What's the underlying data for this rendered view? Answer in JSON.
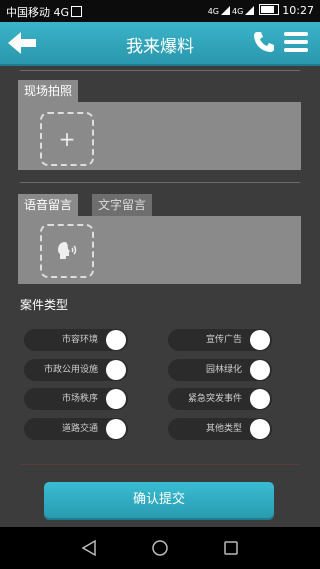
{
  "status_bar": {
    "carrier": "中国移动 4G",
    "network_small": "4G",
    "network_small_b": "4G",
    "time": "10:27"
  },
  "header": {
    "title": "我来爆料"
  },
  "photo_section": {
    "tab_label": "现场拍照",
    "add_symbol": "+"
  },
  "message_section": {
    "tabs": [
      "语音留言",
      "文字留言"
    ]
  },
  "case_type": {
    "title": "案件类型",
    "items_left": [
      "市容环境",
      "市政公用设施",
      "市场秩序",
      "道路交通"
    ],
    "items_right": [
      "宣传广告",
      "园林绿化",
      "紧急突发事件",
      "其他类型"
    ]
  },
  "submit": {
    "label": "确认提交"
  },
  "colors": {
    "accent": "#2fa8bf",
    "background": "#3c3c3c",
    "panel": "#8a8a8a"
  }
}
